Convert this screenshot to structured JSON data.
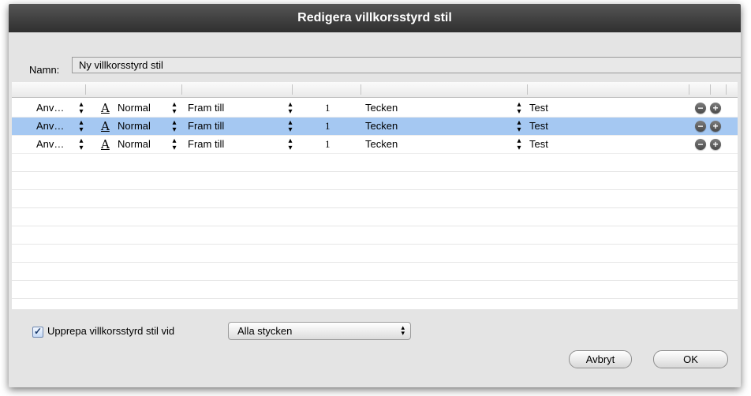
{
  "window": {
    "title": "Redigera villkorsstyrd stil"
  },
  "name_field": {
    "label": "Namn:",
    "value": "Ny villkorsstyrd stil"
  },
  "rows": [
    {
      "apply": "Anv…",
      "char_style": "Normal",
      "range": "Fram till",
      "count": "1",
      "unit": "Tecken",
      "text": "Test",
      "selected": false
    },
    {
      "apply": "Anv…",
      "char_style": "Normal",
      "range": "Fram till",
      "count": "1",
      "unit": "Tecken",
      "text": "Test",
      "selected": true
    },
    {
      "apply": "Anv…",
      "char_style": "Normal",
      "range": "Fram till",
      "count": "1",
      "unit": "Tecken",
      "text": "Test",
      "selected": false
    }
  ],
  "repeat": {
    "checked": true,
    "label": "Upprepa villkorsstyrd stil vid",
    "selected_option": "Alla stycken"
  },
  "buttons": {
    "cancel": "Avbryt",
    "ok": "OK"
  },
  "icons": {
    "char_style": "A",
    "stepper_up": "▴",
    "stepper_down": "▾",
    "remove": "−",
    "add": "+",
    "check": "✓"
  },
  "colors": {
    "titlebar": "#3a3a3a",
    "selection": "#a5c8f2",
    "dialog_bg": "#e4e4e4"
  }
}
